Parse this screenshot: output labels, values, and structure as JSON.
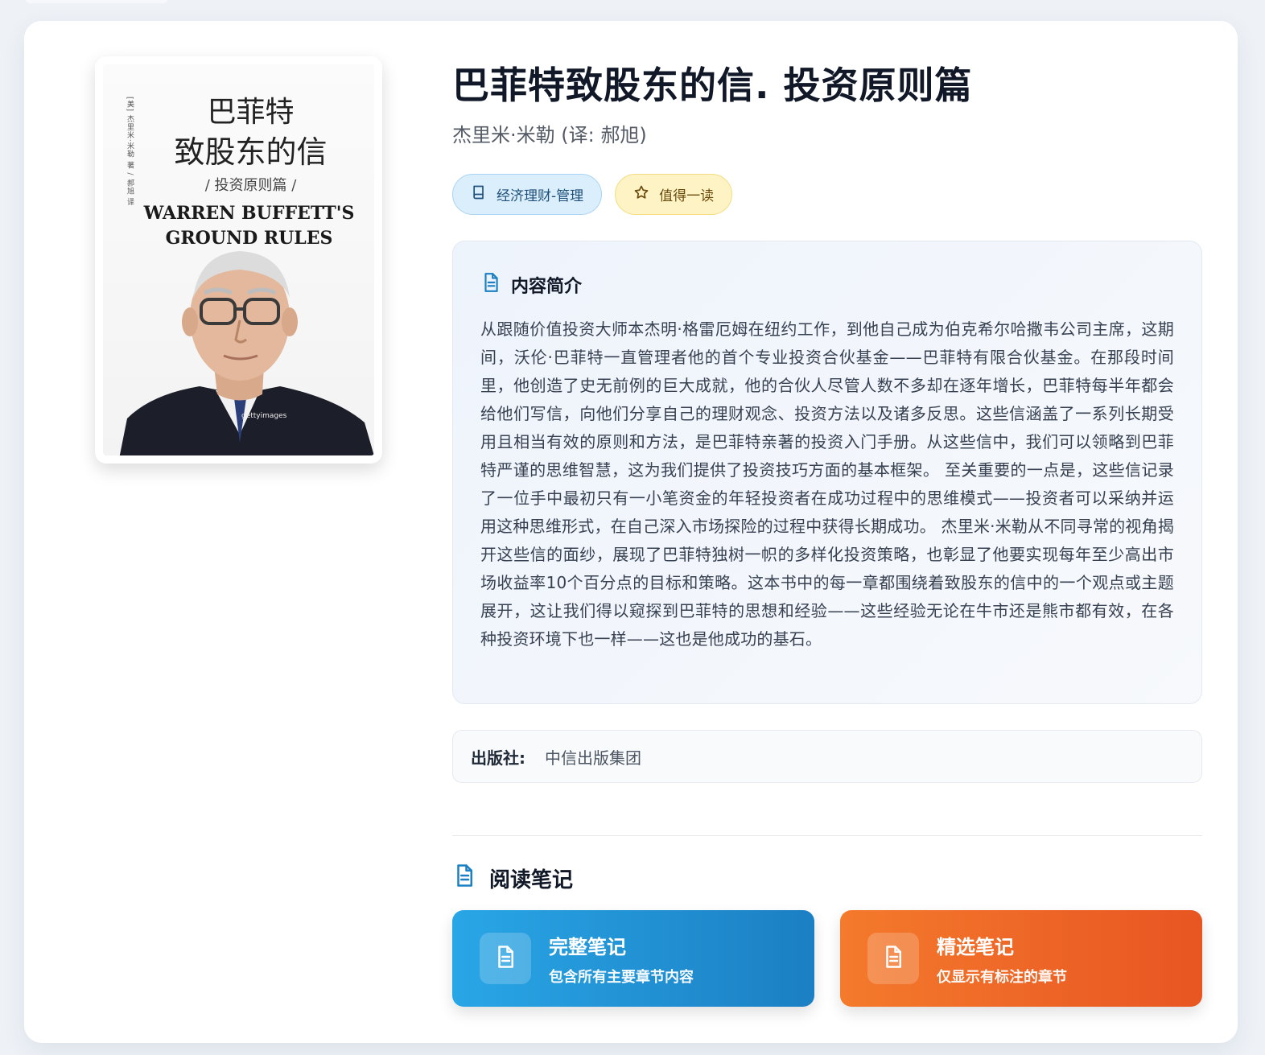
{
  "book": {
    "title": "巴菲特致股东的信. 投资原则篇",
    "author": "杰里米·米勒 (译: 郝旭)"
  },
  "cover": {
    "title_line1": "巴菲特",
    "title_line2": "致股东的信",
    "subtitle": "/ 投资原则篇 /",
    "en_line1": "WARREN BUFFETT'S",
    "en_line2": "GROUND RULES",
    "vertical_text": "[美] 杰里米·米勒 著 / 郝旭 译",
    "brand": "gettyimages"
  },
  "tags": [
    {
      "label": "经济理财-管理",
      "icon": "book-icon"
    },
    {
      "label": "值得一读",
      "icon": "star-icon"
    }
  ],
  "summary": {
    "heading": "内容简介",
    "text": "从跟随价值投资大师本杰明·格雷厄姆在纽约工作，到他自己成为伯克希尔哈撒韦公司主席，这期间，沃伦·巴菲特一直管理者他的首个专业投资合伙基金——巴菲特有限合伙基金。在那段时间里，他创造了史无前例的巨大成就，他的合伙人尽管人数不多却在逐年增长，巴菲特每半年都会给他们写信，向他们分享自己的理财观念、投资方法以及诸多反思。这些信涵盖了一系列长期受用且相当有效的原则和方法，是巴菲特亲著的投资入门手册。从这些信中，我们可以领略到巴菲特严谨的思维智慧，这为我们提供了投资技巧方面的基本框架。 至关重要的一点是，这些信记录了一位手中最初只有一小笔资金的年轻投资者在成功过程中的思维模式——投资者可以采纳并运用这种思维形式，在自己深入市场探险的过程中获得长期成功。 杰里米·米勒从不同寻常的视角揭开这些信的面纱，展现了巴菲特独树一帜的多样化投资策略，也彰显了他要实现每年至少高出市场收益率10个百分点的目标和策略。这本书中的每一章都围绕着致股东的信中的一个观点或主题展开，这让我们得以窥探到巴菲特的思想和经验——这些经验无论在牛市还是熊市都有效，在各种投资环境下也一样——这也是他成功的基石。"
  },
  "publisher": {
    "label": "出版社:",
    "value": "中信出版集团"
  },
  "notes": {
    "heading": "阅读笔记",
    "full": {
      "title": "完整笔记",
      "subtitle": "包含所有主要章节内容"
    },
    "selected": {
      "title": "精选笔记",
      "subtitle": "仅显示有标注的章节"
    }
  },
  "colors": {
    "full_note_gradient": [
      "#29a6e6",
      "#1b7fc3"
    ],
    "selected_note_gradient": [
      "#f47a2c",
      "#e85522"
    ],
    "tag_blue_bg": "#dbeefc",
    "tag_yellow_bg": "#fdf3c4"
  }
}
